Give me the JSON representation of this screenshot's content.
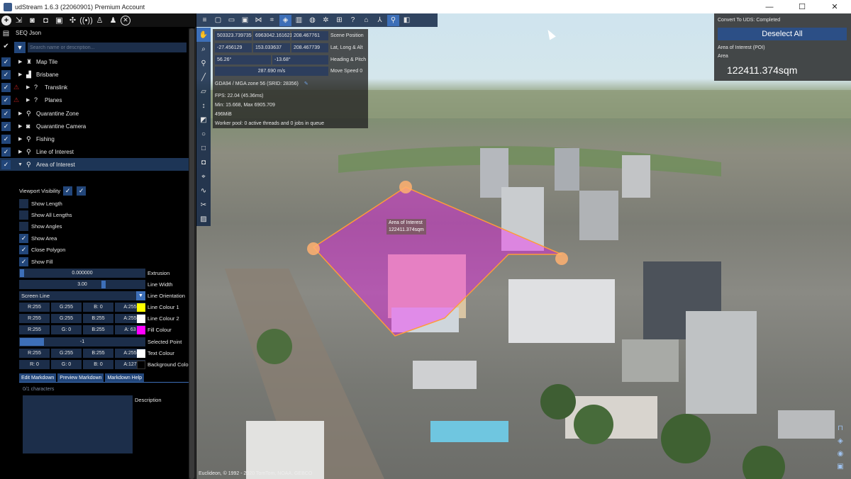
{
  "window": {
    "title": "udStream 1.6.3 (22060901) Premium Account",
    "controls": {
      "minimize": "—",
      "maximize": "☐",
      "close": "✕"
    }
  },
  "left_toolbar": {
    "icons": [
      "add-icon",
      "import-icon",
      "camera-icon",
      "screenshot-icon",
      "save-icon",
      "share-icon",
      "broadcast-icon",
      "user-up-icon",
      "user-down-icon",
      "close-circle-icon"
    ]
  },
  "scene": {
    "title": "SEQ Json",
    "search_placeholder": "Search name or description...",
    "items": [
      {
        "label": "Map Tile",
        "icon": "map-tile-icon",
        "warn": false,
        "expanded": false
      },
      {
        "label": "Brisbane",
        "icon": "building-icon",
        "warn": false,
        "expanded": false
      },
      {
        "label": "Translink",
        "icon": "unknown-icon",
        "warn": true,
        "expanded": false
      },
      {
        "label": "Planes",
        "icon": "unknown-icon",
        "warn": true,
        "expanded": false
      },
      {
        "label": "Quarantine Zone",
        "icon": "pin-icon",
        "warn": false,
        "expanded": false
      },
      {
        "label": "Quarantine Camera",
        "icon": "camera-icon",
        "warn": false,
        "expanded": false
      },
      {
        "label": "Fishing",
        "icon": "pin-icon",
        "warn": false,
        "expanded": false
      },
      {
        "label": "Line of Interest",
        "icon": "pin-icon",
        "warn": false,
        "expanded": false
      },
      {
        "label": "Area of Interest",
        "icon": "pin-icon",
        "warn": false,
        "expanded": true
      }
    ]
  },
  "properties": {
    "viewport_visibility": "Viewport Visibility",
    "options": [
      {
        "label": "Show Length",
        "checked": false
      },
      {
        "label": "Show All Lengths",
        "checked": false
      },
      {
        "label": "Show Angles",
        "checked": false
      },
      {
        "label": "Show Area",
        "checked": true
      },
      {
        "label": "Close Polygon",
        "checked": true
      },
      {
        "label": "Show Fill",
        "checked": true
      }
    ],
    "extrusion": {
      "value": "0.000000",
      "label": "Extrusion"
    },
    "line_width": {
      "value": "3.00",
      "label": "Line Width"
    },
    "line_orientation": {
      "value": "Screen Line",
      "label": "Line Orientation"
    },
    "line_colour_1": {
      "r": "R:255",
      "g": "G:255",
      "b": "B: 0",
      "a": "A:255",
      "label": "Line Colour 1",
      "swatch": "#ffff00"
    },
    "line_colour_2": {
      "r": "R:255",
      "g": "G:255",
      "b": "B:255",
      "a": "A:255",
      "label": "Line Colour 2",
      "swatch": "#ffffff"
    },
    "fill_colour": {
      "r": "R:255",
      "g": "G: 0",
      "b": "B:255",
      "a": "A: 63",
      "label": "Fill Colour",
      "swatch": "#ff00ff"
    },
    "selected_point": {
      "value": "-1",
      "label": "Selected Point"
    },
    "text_colour": {
      "r": "R:255",
      "g": "G:255",
      "b": "B:255",
      "a": "A:255",
      "label": "Text Colour",
      "swatch": "#ffffff"
    },
    "background_colour": {
      "r": "R: 0",
      "g": "G: 0",
      "b": "B: 0",
      "a": "A:127",
      "label": "Background Colour",
      "swatch": "#000000"
    },
    "tabs": [
      "Edit Markdown",
      "Preview Markdown",
      "Markdown Help"
    ],
    "char_count": "0/1 characters",
    "description_label": "Description"
  },
  "viewport": {
    "scene_position": {
      "x": "503323.739735",
      "y": "6963042.161621",
      "z": "208.467761",
      "label": "Scene Position"
    },
    "lat_long_alt": {
      "lat": "-27.456129",
      "lon": "153.033637",
      "alt": "208.467739",
      "label": "Lat, Long & Alt"
    },
    "heading_pitch": {
      "heading": "56.26°",
      "pitch": "-13.68°",
      "label": "Heading & Pitch"
    },
    "move_speed": {
      "value": "287.690 m/s",
      "label": "Move Speed 0"
    },
    "srid": "GDA94 / MGA zone 56 (SRID: 28356)",
    "fps": "FPS: 22.04 (45.36ms)",
    "minmax": "Min: 15.668, Max 6905.709",
    "memory": "496MiB",
    "worker": "Worker pool: 0 active threads and 0 jobs in queue",
    "aoi_label_name": "Area of Interest",
    "aoi_label_area": "122411.374sqm",
    "copyright": "Euclideon, © 1992 - 2020 TomTom, NOAA, GEBCO"
  },
  "right_panel": {
    "status": "Convert To UDS: Completed",
    "deselect_button": "Deselect All",
    "poi_label": "Area of Interest (POI)",
    "area_label": "Area",
    "area_value": "122411.374sqm"
  }
}
